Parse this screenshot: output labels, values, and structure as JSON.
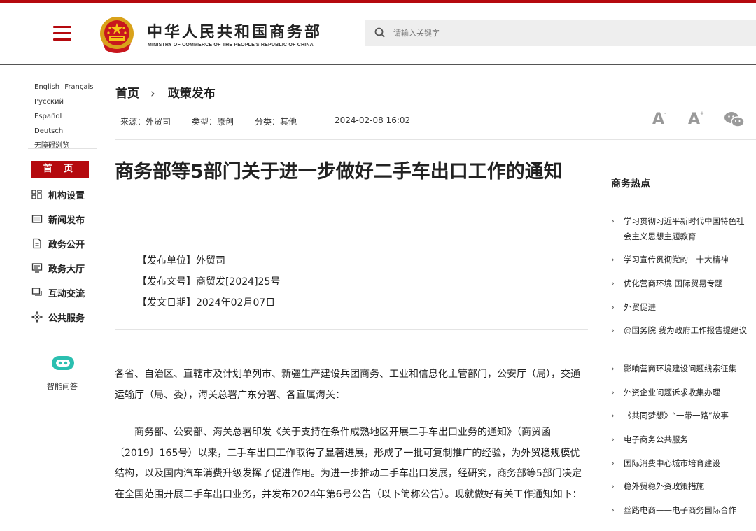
{
  "header": {
    "site_title": "中华人民共和国商务部",
    "site_subtitle": "MINISTRY OF COMMERCE OF THE PEOPLE'S REPUBLIC OF CHINA",
    "search_placeholder": "请输入关键字",
    "brand_color": "#b5090e"
  },
  "sidebar": {
    "languages": [
      "English",
      "Français",
      "Русский",
      "Español",
      "Deutsch"
    ],
    "accessibility": "无障碍浏览",
    "home_label": "首 页",
    "nav": [
      {
        "label": "机构设置",
        "icon": "org-grid-icon"
      },
      {
        "label": "新闻发布",
        "icon": "news-icon"
      },
      {
        "label": "政务公开",
        "icon": "document-icon"
      },
      {
        "label": "政务大厅",
        "icon": "monitor-icon"
      },
      {
        "label": "互动交流",
        "icon": "chat-icon"
      },
      {
        "label": "公共服务",
        "icon": "service-icon"
      }
    ],
    "assistant_label": "智能问答"
  },
  "breadcrumb": {
    "home": "首页",
    "current": "政策发布"
  },
  "meta": {
    "source": "来源：外贸司",
    "type": "类型：原创",
    "category": "分类：其他",
    "datetime": "2024-02-08 16:02",
    "font_large": "A",
    "font_small": "A"
  },
  "article": {
    "title": "商务部等5部门关于进一步做好二手车出口工作的通知",
    "issuer": "【发布单位】外贸司",
    "doc_number": "【发布文号】商贸发[2024]25号",
    "issue_date": "【发文日期】2024年02月07日",
    "addressee": "各省、自治区、直辖市及计划单列市、新疆生产建设兵团商务、工业和信息化主管部门，公安厅（局），交通运输厅（局、委），海关总署广东分署、各直属海关：",
    "paragraph1": "商务部、公安部、海关总署印发《关于支持在条件成熟地区开展二手车出口业务的通知》（商贸函〔2019〕165号）以来，二手车出口工作取得了显著进展，形成了一批可复制推广的经验，为外贸稳规模优结构，以及国内汽车消费升级发挥了促进作用。为进一步推动二手车出口发展，经研究，商务部等5部门决定在全国范围开展二手车出口业务，并发布2024年第6号公告（以下简称公告）。现就做好有关工作通知如下："
  },
  "hot": {
    "title": "商务热点",
    "items": [
      "学习贯彻习近平新时代中国特色社会主义思想主题教育",
      "学习宣传贯彻党的二十大精神",
      "优化营商环境 国际贸易专题",
      "外贸促进",
      "@国务院 我为政府工作报告提建议",
      "影响营商环境建设问题线索征集",
      "外资企业问题诉求收集办理",
      "《共同梦想》“一带一路”故事",
      "电子商务公共服务",
      "国际消费中心城市培育建设",
      "稳外贸稳外资政策措施",
      "丝路电商——电子商务国际合作"
    ]
  }
}
